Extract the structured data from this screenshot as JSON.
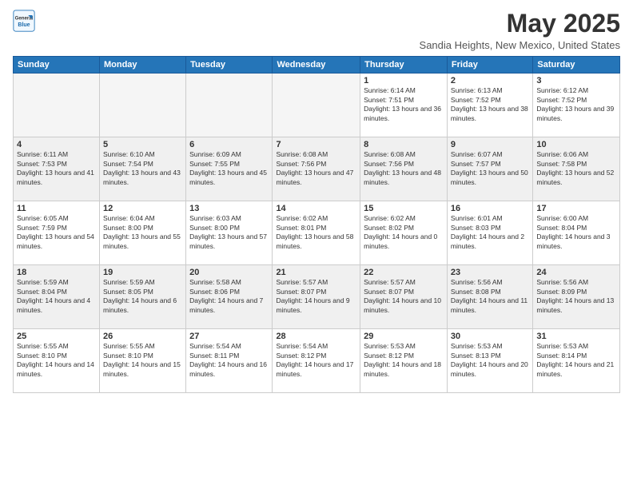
{
  "logo": {
    "general": "General",
    "blue": "Blue"
  },
  "title": "May 2025",
  "location": "Sandia Heights, New Mexico, United States",
  "weekdays": [
    "Sunday",
    "Monday",
    "Tuesday",
    "Wednesday",
    "Thursday",
    "Friday",
    "Saturday"
  ],
  "weeks": [
    [
      {
        "day": "",
        "sunrise": "",
        "sunset": "",
        "daylight": "",
        "empty": true
      },
      {
        "day": "",
        "sunrise": "",
        "sunset": "",
        "daylight": "",
        "empty": true
      },
      {
        "day": "",
        "sunrise": "",
        "sunset": "",
        "daylight": "",
        "empty": true
      },
      {
        "day": "",
        "sunrise": "",
        "sunset": "",
        "daylight": "",
        "empty": true
      },
      {
        "day": "1",
        "sunrise": "Sunrise: 6:14 AM",
        "sunset": "Sunset: 7:51 PM",
        "daylight": "Daylight: 13 hours and 36 minutes.",
        "empty": false
      },
      {
        "day": "2",
        "sunrise": "Sunrise: 6:13 AM",
        "sunset": "Sunset: 7:52 PM",
        "daylight": "Daylight: 13 hours and 38 minutes.",
        "empty": false
      },
      {
        "day": "3",
        "sunrise": "Sunrise: 6:12 AM",
        "sunset": "Sunset: 7:52 PM",
        "daylight": "Daylight: 13 hours and 39 minutes.",
        "empty": false
      }
    ],
    [
      {
        "day": "4",
        "sunrise": "Sunrise: 6:11 AM",
        "sunset": "Sunset: 7:53 PM",
        "daylight": "Daylight: 13 hours and 41 minutes.",
        "empty": false
      },
      {
        "day": "5",
        "sunrise": "Sunrise: 6:10 AM",
        "sunset": "Sunset: 7:54 PM",
        "daylight": "Daylight: 13 hours and 43 minutes.",
        "empty": false
      },
      {
        "day": "6",
        "sunrise": "Sunrise: 6:09 AM",
        "sunset": "Sunset: 7:55 PM",
        "daylight": "Daylight: 13 hours and 45 minutes.",
        "empty": false
      },
      {
        "day": "7",
        "sunrise": "Sunrise: 6:08 AM",
        "sunset": "Sunset: 7:56 PM",
        "daylight": "Daylight: 13 hours and 47 minutes.",
        "empty": false
      },
      {
        "day": "8",
        "sunrise": "Sunrise: 6:08 AM",
        "sunset": "Sunset: 7:56 PM",
        "daylight": "Daylight: 13 hours and 48 minutes.",
        "empty": false
      },
      {
        "day": "9",
        "sunrise": "Sunrise: 6:07 AM",
        "sunset": "Sunset: 7:57 PM",
        "daylight": "Daylight: 13 hours and 50 minutes.",
        "empty": false
      },
      {
        "day": "10",
        "sunrise": "Sunrise: 6:06 AM",
        "sunset": "Sunset: 7:58 PM",
        "daylight": "Daylight: 13 hours and 52 minutes.",
        "empty": false
      }
    ],
    [
      {
        "day": "11",
        "sunrise": "Sunrise: 6:05 AM",
        "sunset": "Sunset: 7:59 PM",
        "daylight": "Daylight: 13 hours and 54 minutes.",
        "empty": false
      },
      {
        "day": "12",
        "sunrise": "Sunrise: 6:04 AM",
        "sunset": "Sunset: 8:00 PM",
        "daylight": "Daylight: 13 hours and 55 minutes.",
        "empty": false
      },
      {
        "day": "13",
        "sunrise": "Sunrise: 6:03 AM",
        "sunset": "Sunset: 8:00 PM",
        "daylight": "Daylight: 13 hours and 57 minutes.",
        "empty": false
      },
      {
        "day": "14",
        "sunrise": "Sunrise: 6:02 AM",
        "sunset": "Sunset: 8:01 PM",
        "daylight": "Daylight: 13 hours and 58 minutes.",
        "empty": false
      },
      {
        "day": "15",
        "sunrise": "Sunrise: 6:02 AM",
        "sunset": "Sunset: 8:02 PM",
        "daylight": "Daylight: 14 hours and 0 minutes.",
        "empty": false
      },
      {
        "day": "16",
        "sunrise": "Sunrise: 6:01 AM",
        "sunset": "Sunset: 8:03 PM",
        "daylight": "Daylight: 14 hours and 2 minutes.",
        "empty": false
      },
      {
        "day": "17",
        "sunrise": "Sunrise: 6:00 AM",
        "sunset": "Sunset: 8:04 PM",
        "daylight": "Daylight: 14 hours and 3 minutes.",
        "empty": false
      }
    ],
    [
      {
        "day": "18",
        "sunrise": "Sunrise: 5:59 AM",
        "sunset": "Sunset: 8:04 PM",
        "daylight": "Daylight: 14 hours and 4 minutes.",
        "empty": false
      },
      {
        "day": "19",
        "sunrise": "Sunrise: 5:59 AM",
        "sunset": "Sunset: 8:05 PM",
        "daylight": "Daylight: 14 hours and 6 minutes.",
        "empty": false
      },
      {
        "day": "20",
        "sunrise": "Sunrise: 5:58 AM",
        "sunset": "Sunset: 8:06 PM",
        "daylight": "Daylight: 14 hours and 7 minutes.",
        "empty": false
      },
      {
        "day": "21",
        "sunrise": "Sunrise: 5:57 AM",
        "sunset": "Sunset: 8:07 PM",
        "daylight": "Daylight: 14 hours and 9 minutes.",
        "empty": false
      },
      {
        "day": "22",
        "sunrise": "Sunrise: 5:57 AM",
        "sunset": "Sunset: 8:07 PM",
        "daylight": "Daylight: 14 hours and 10 minutes.",
        "empty": false
      },
      {
        "day": "23",
        "sunrise": "Sunrise: 5:56 AM",
        "sunset": "Sunset: 8:08 PM",
        "daylight": "Daylight: 14 hours and 11 minutes.",
        "empty": false
      },
      {
        "day": "24",
        "sunrise": "Sunrise: 5:56 AM",
        "sunset": "Sunset: 8:09 PM",
        "daylight": "Daylight: 14 hours and 13 minutes.",
        "empty": false
      }
    ],
    [
      {
        "day": "25",
        "sunrise": "Sunrise: 5:55 AM",
        "sunset": "Sunset: 8:10 PM",
        "daylight": "Daylight: 14 hours and 14 minutes.",
        "empty": false
      },
      {
        "day": "26",
        "sunrise": "Sunrise: 5:55 AM",
        "sunset": "Sunset: 8:10 PM",
        "daylight": "Daylight: 14 hours and 15 minutes.",
        "empty": false
      },
      {
        "day": "27",
        "sunrise": "Sunrise: 5:54 AM",
        "sunset": "Sunset: 8:11 PM",
        "daylight": "Daylight: 14 hours and 16 minutes.",
        "empty": false
      },
      {
        "day": "28",
        "sunrise": "Sunrise: 5:54 AM",
        "sunset": "Sunset: 8:12 PM",
        "daylight": "Daylight: 14 hours and 17 minutes.",
        "empty": false
      },
      {
        "day": "29",
        "sunrise": "Sunrise: 5:53 AM",
        "sunset": "Sunset: 8:12 PM",
        "daylight": "Daylight: 14 hours and 18 minutes.",
        "empty": false
      },
      {
        "day": "30",
        "sunrise": "Sunrise: 5:53 AM",
        "sunset": "Sunset: 8:13 PM",
        "daylight": "Daylight: 14 hours and 20 minutes.",
        "empty": false
      },
      {
        "day": "31",
        "sunrise": "Sunrise: 5:53 AM",
        "sunset": "Sunset: 8:14 PM",
        "daylight": "Daylight: 14 hours and 21 minutes.",
        "empty": false
      }
    ]
  ]
}
